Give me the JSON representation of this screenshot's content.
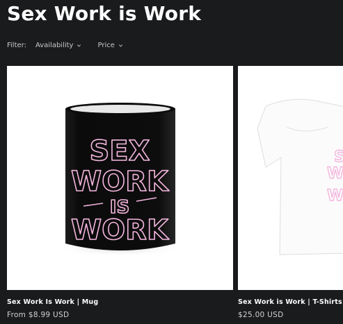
{
  "collection": {
    "title": "Sex Work is Work"
  },
  "filters": {
    "label": "Filter:",
    "availability_label": "Availability",
    "price_label": "Price"
  },
  "products": [
    {
      "title": "Sex Work Is Work | Mug",
      "price": "From $8.99 USD",
      "art_text": [
        "SEX",
        "WORK",
        "IS",
        "WORK"
      ]
    },
    {
      "title": "Sex Work is Work | T-Shirts",
      "price": "$25.00 USD",
      "art_text": [
        "S",
        "W",
        "W"
      ]
    }
  ],
  "colors": {
    "background": "#1a1b1d",
    "neon_pink": "#f3b6de",
    "mug_body": "#111111"
  }
}
